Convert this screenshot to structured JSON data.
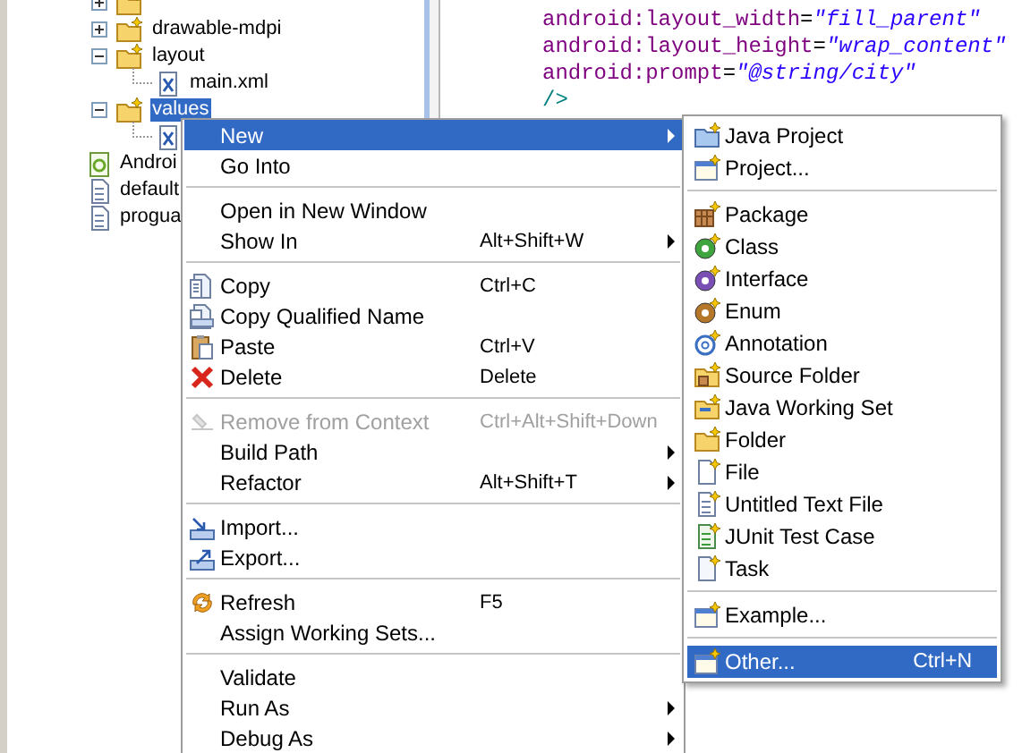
{
  "tree": {
    "folders": [
      {
        "expanded": false
      },
      {
        "label": "drawable-mdpi",
        "expanded": false,
        "selected": false
      },
      {
        "label": "layout",
        "expanded": true,
        "selected": false,
        "children": [
          {
            "kind": "xml-file",
            "label": "main.xml",
            "selected": false
          }
        ]
      },
      {
        "label": "values",
        "expanded": true,
        "selected": true,
        "children": [
          {
            "kind": "xml-file"
          }
        ]
      }
    ],
    "files": [
      {
        "kind": "android-file",
        "label": "Androi",
        "selected": false
      },
      {
        "kind": "text-file",
        "label": "default",
        "selected": false
      },
      {
        "kind": "text-file",
        "label": "progua",
        "selected": false
      }
    ]
  },
  "editor": {
    "lines": [
      [
        {
          "kind": "attribute",
          "text": "android:layout_width"
        },
        {
          "kind": "operator",
          "text": "="
        },
        {
          "kind": "value",
          "text": "\"fill_parent\""
        }
      ],
      [
        {
          "kind": "attribute",
          "text": "android:layout_height"
        },
        {
          "kind": "operator",
          "text": "="
        },
        {
          "kind": "value",
          "text": "\"wrap_content\""
        }
      ],
      [
        {
          "kind": "attribute",
          "text": "android:prompt"
        },
        {
          "kind": "operator",
          "text": "="
        },
        {
          "kind": "value",
          "text": "\"@string/city\""
        }
      ],
      [
        {
          "kind": "tag",
          "text": "/>"
        }
      ]
    ]
  },
  "context_menu": {
    "groups": [
      {
        "items": [
          {
            "label": "New",
            "submenu": true,
            "selected": true,
            "disabled": false
          },
          {
            "label": "Go Into",
            "selected": false,
            "disabled": false
          }
        ]
      },
      {
        "items": [
          {
            "label": "Open in New Window",
            "selected": false,
            "disabled": false
          },
          {
            "label": "Show In",
            "shortcut": "Alt+Shift+W",
            "submenu": true,
            "selected": false,
            "disabled": false
          }
        ]
      },
      {
        "items": [
          {
            "label": "Copy",
            "shortcut": "Ctrl+C",
            "selected": false,
            "disabled": false
          },
          {
            "label": "Copy Qualified Name",
            "selected": false,
            "disabled": false
          },
          {
            "label": "Paste",
            "shortcut": "Ctrl+V",
            "selected": false,
            "disabled": false
          },
          {
            "label": "Delete",
            "shortcut": "Delete",
            "selected": false,
            "disabled": false
          }
        ]
      },
      {
        "items": [
          {
            "label": "Remove from Context",
            "shortcut": "Ctrl+Alt+Shift+Down",
            "selected": false,
            "disabled": true
          },
          {
            "label": "Build Path",
            "submenu": true,
            "selected": false,
            "disabled": false
          },
          {
            "label": "Refactor",
            "shortcut": "Alt+Shift+T",
            "submenu": true,
            "selected": false,
            "disabled": false
          }
        ]
      },
      {
        "items": [
          {
            "label": "Import...",
            "selected": false,
            "disabled": false
          },
          {
            "label": "Export...",
            "selected": false,
            "disabled": false
          }
        ]
      },
      {
        "items": [
          {
            "label": "Refresh",
            "shortcut": "F5",
            "selected": false,
            "disabled": false
          },
          {
            "label": "Assign Working Sets...",
            "selected": false,
            "disabled": false
          }
        ]
      },
      {
        "items": [
          {
            "label": "Validate",
            "selected": false,
            "disabled": false
          },
          {
            "label": "Run As",
            "submenu": true,
            "selected": false,
            "disabled": false
          },
          {
            "label": "Debug As",
            "submenu": true,
            "selected": false,
            "disabled": false
          }
        ]
      }
    ]
  },
  "new_submenu": {
    "groups": [
      {
        "items": [
          {
            "label": "Java Project",
            "selected": false
          },
          {
            "label": "Project...",
            "selected": false
          }
        ]
      },
      {
        "items": [
          {
            "label": "Package",
            "selected": false
          },
          {
            "label": "Class",
            "selected": false
          },
          {
            "label": "Interface",
            "selected": false
          },
          {
            "label": "Enum",
            "selected": false
          },
          {
            "label": "Annotation",
            "selected": false
          },
          {
            "label": "Source Folder",
            "selected": false
          },
          {
            "label": "Java Working Set",
            "selected": false
          },
          {
            "label": "Folder",
            "selected": false
          },
          {
            "label": "File",
            "selected": false
          },
          {
            "label": "Untitled Text File",
            "selected": false
          },
          {
            "label": "JUnit Test Case",
            "selected": false
          },
          {
            "label": "Task",
            "selected": false
          }
        ]
      },
      {
        "items": [
          {
            "label": "Example...",
            "selected": false
          }
        ]
      },
      {
        "items": [
          {
            "label": "Other...",
            "shortcut": "Ctrl+N",
            "selected": true
          }
        ]
      }
    ]
  }
}
